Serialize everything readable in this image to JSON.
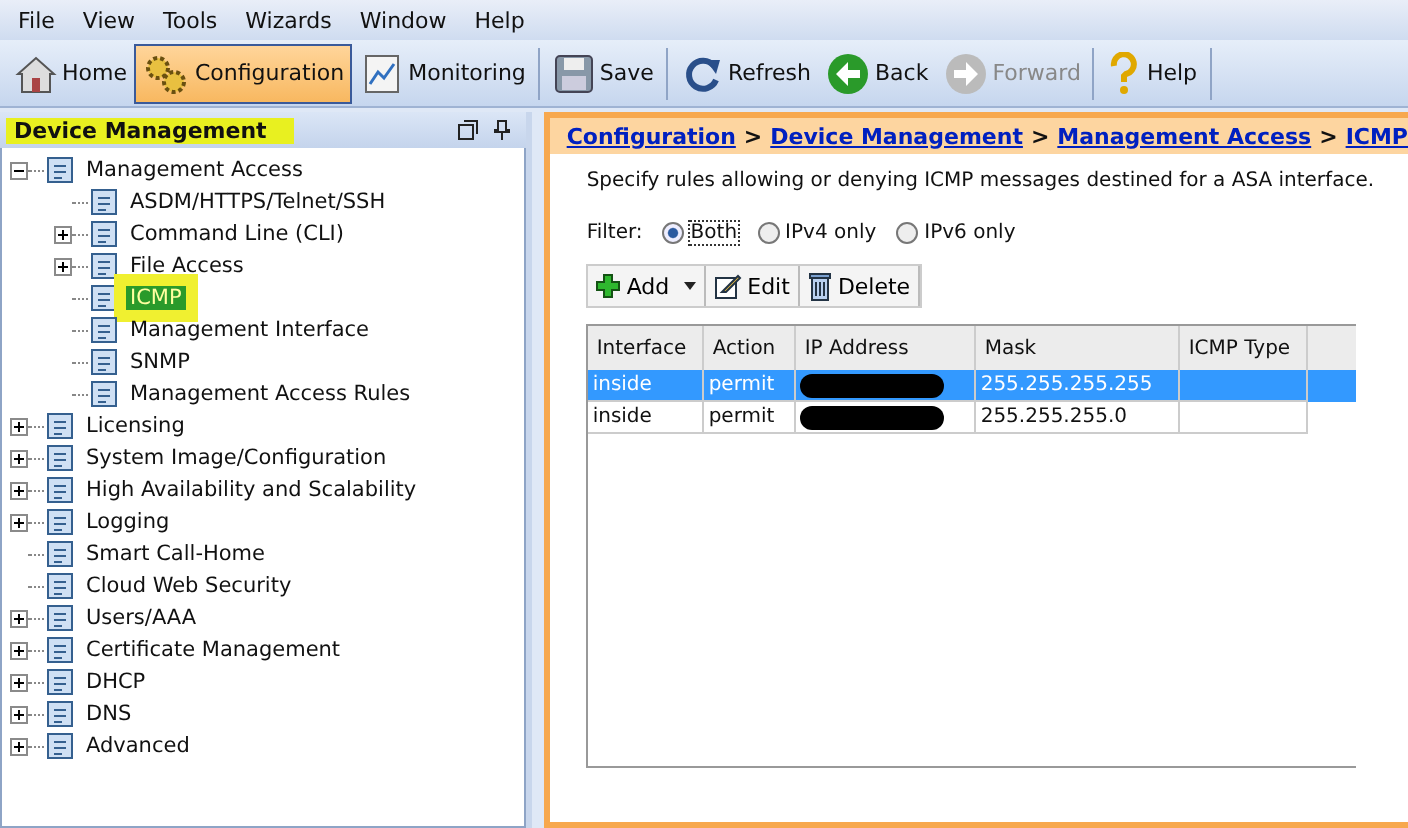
{
  "menu": [
    "File",
    "View",
    "Tools",
    "Wizards",
    "Window",
    "Help"
  ],
  "toolbar": [
    {
      "label": "Home",
      "kind": "home",
      "selected": false,
      "disabled": false
    },
    {
      "label": "Configuration",
      "kind": "gears",
      "selected": true,
      "disabled": false
    },
    {
      "label": "Monitoring",
      "kind": "chart",
      "selected": false,
      "disabled": false
    },
    {
      "label": "Save",
      "kind": "save",
      "selected": false,
      "disabled": false
    },
    {
      "label": "Refresh",
      "kind": "refresh",
      "selected": false,
      "disabled": false
    },
    {
      "label": "Back",
      "kind": "back",
      "selected": false,
      "disabled": false
    },
    {
      "label": "Forward",
      "kind": "forward",
      "selected": false,
      "disabled": true
    },
    {
      "label": "Help",
      "kind": "help",
      "selected": false,
      "disabled": false
    }
  ],
  "sidebar": {
    "title": "Device Management",
    "items": [
      {
        "label": "Management Access",
        "expanded": true,
        "selected": false,
        "children": [
          {
            "label": "ASDM/HTTPS/Telnet/SSH",
            "selected": false
          },
          {
            "label": "Command Line (CLI)",
            "expanded": false,
            "selected": false
          },
          {
            "label": "File Access",
            "expanded": false,
            "selected": false
          },
          {
            "label": "ICMP",
            "selected": true
          },
          {
            "label": "Management Interface",
            "selected": false
          },
          {
            "label": "SNMP",
            "selected": false
          },
          {
            "label": "Management Access Rules",
            "selected": false
          }
        ]
      },
      {
        "label": "Licensing",
        "expanded": false,
        "selected": false
      },
      {
        "label": "System Image/Configuration",
        "expanded": false,
        "selected": false
      },
      {
        "label": "High Availability and Scalability",
        "expanded": false,
        "selected": false
      },
      {
        "label": "Logging",
        "expanded": false,
        "selected": false
      },
      {
        "label": "Smart Call-Home",
        "selected": false
      },
      {
        "label": "Cloud Web Security",
        "selected": false
      },
      {
        "label": "Users/AAA",
        "expanded": false,
        "selected": false
      },
      {
        "label": "Certificate Management",
        "expanded": false,
        "selected": false
      },
      {
        "label": "DHCP",
        "expanded": false,
        "selected": false
      },
      {
        "label": "DNS",
        "expanded": false,
        "selected": false
      },
      {
        "label": "Advanced",
        "expanded": false,
        "selected": false
      }
    ]
  },
  "breadcrumb": [
    "Configuration",
    "Device Management",
    "Management Access",
    "ICMP"
  ],
  "breadcrumb_separator": ">",
  "description": "Specify rules allowing or denying ICMP messages destined for a ASA interface.",
  "filter": {
    "label": "Filter:",
    "options": [
      {
        "label": "Both",
        "selected": true
      },
      {
        "label": "IPv4 only",
        "selected": false
      },
      {
        "label": "IPv6 only",
        "selected": false
      }
    ]
  },
  "actions": [
    {
      "label": "Add",
      "kind": "add"
    },
    {
      "label": "Edit",
      "kind": "edit"
    },
    {
      "label": "Delete",
      "kind": "delete"
    }
  ],
  "table": {
    "columns": [
      "Interface",
      "Action",
      "IP Address",
      "Mask",
      "ICMP Type"
    ],
    "rows": [
      {
        "selected": true,
        "cells": [
          "inside",
          "permit",
          null,
          "255.255.255.255",
          ""
        ]
      },
      {
        "selected": false,
        "cells": [
          "inside",
          "permit",
          null,
          "255.255.255.0",
          ""
        ]
      }
    ]
  }
}
